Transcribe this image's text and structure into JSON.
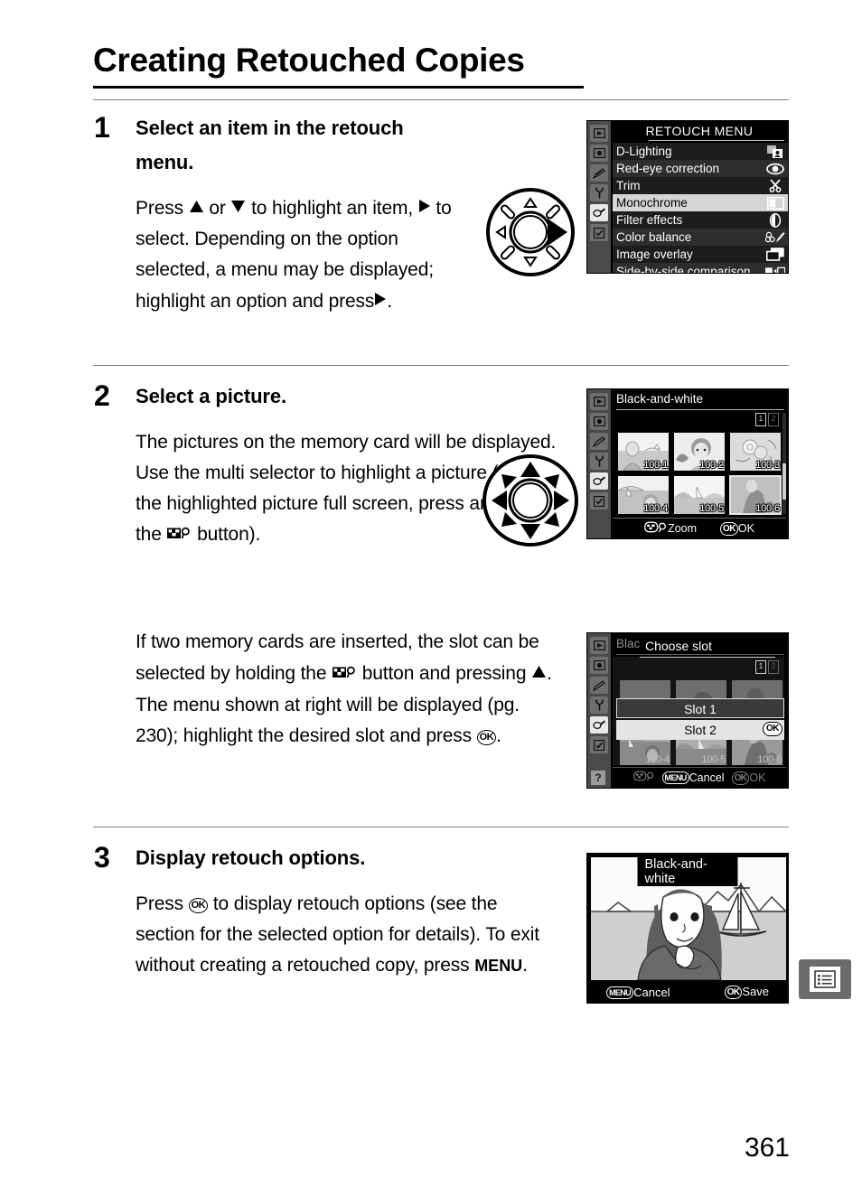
{
  "page": {
    "title": "Creating Retouched Copies",
    "number": "361",
    "side_tab_icon": "menu-list-icon"
  },
  "steps": [
    {
      "number": "1",
      "heading": "Select an item in the retouch menu.",
      "paragraphs": [
        "Press ▲ or ▼ to highlight an item, ▶ to select.  Depending on the option selected, a menu may be displayed; highlight an option and press ▶."
      ]
    },
    {
      "number": "2",
      "heading": "Select a picture.",
      "paragraphs": [
        "The pictures on the memory card will be displayed.  Use the multi selector to highlight a picture (to view the highlighted picture full screen, press and hold the ▣ button).",
        "If two memory cards are inserted, the slot can be selected by holding the ▣ button and pressing ▲.  The menu shown at right will be displayed (pg. 230); highlight the desired slot and press ⒪."
      ]
    },
    {
      "number": "3",
      "heading": "Display retouch options.",
      "paragraphs": [
        "Press ⒪ to display retouch options (see the section for the selected option for details).  To exit without creating a retouched copy, press MENU."
      ]
    }
  ],
  "step1_text": {
    "press": "Press",
    "or": "or",
    "to_highlight": "to highlight an item,",
    "to_select": "to select.  Depending on the option selected, a menu may be displayed; highlight an option and press",
    "period": "."
  },
  "step2_text": {
    "para1_a": "The pictures on the memory card will be displayed.  Use the multi selector to highlight a picture (to view the highlighted picture full screen, press and hold the",
    "para1_b": "button).",
    "para2_a": "If two memory cards are inserted, the slot can be selected by holding the",
    "para2_b": "button and pressing",
    "para2_c": ".  The menu shown at right will be displayed (pg. 230); highlight the desired slot and press",
    "para2_d": "."
  },
  "step3_text": {
    "a": "Press",
    "b": "to display retouch options (see the section for the selected option for details).  To exit without creating a retouched copy, press",
    "menu_word": "MENU",
    "c": "."
  },
  "dials": {
    "step1": {
      "name": "multi-selector-right",
      "highlighted_direction": "right"
    },
    "step2": {
      "name": "multi-selector-all",
      "highlighted_direction": "all"
    }
  },
  "lcd_retouch_menu": {
    "title": "RETOUCH MENU",
    "sidebar_icons": [
      "playback-icon",
      "shooting-menu-icon",
      "custom-settings-pencil-icon",
      "setup-wrench-icon",
      "retouch-brush-icon",
      "recent-settings-icon"
    ],
    "selected_sidebar_index": 4,
    "items": [
      {
        "label": "D-Lighting",
        "icon": "d-lighting-icon",
        "highlighted": false
      },
      {
        "label": "Red-eye correction",
        "icon": "red-eye-icon",
        "highlighted": false
      },
      {
        "label": "Trim",
        "icon": "scissors-icon",
        "highlighted": false
      },
      {
        "label": "Monochrome",
        "icon": "monochrome-icon",
        "highlighted": true
      },
      {
        "label": "Filter effects",
        "icon": "filter-effects-icon",
        "highlighted": false
      },
      {
        "label": "Color balance",
        "icon": "color-balance-icon",
        "highlighted": false
      },
      {
        "label": "Image overlay",
        "icon": "image-overlay-icon",
        "highlighted": false
      },
      {
        "label": "Side-by-side comparison",
        "icon": "side-by-side-icon",
        "highlighted": false
      }
    ]
  },
  "lcd_thumbnails": {
    "title": "Black-and-white",
    "card_indicators": [
      "1",
      "2"
    ],
    "thumbnails": [
      {
        "label": "100-1",
        "selected": false
      },
      {
        "label": "100-2",
        "selected": false
      },
      {
        "label": "100-3",
        "selected": false
      },
      {
        "label": "100-4",
        "selected": false
      },
      {
        "label": "100-5",
        "selected": false
      },
      {
        "label": "100-6",
        "selected": true
      }
    ],
    "bottom_left_label": "Zoom",
    "bottom_right_label": "OK",
    "bottom_right_badge": "OK",
    "bottom_left_badge": "zoom-thumbnail-icon"
  },
  "lcd_choose_slot": {
    "background_title": "Black-and-white",
    "dialog_title": "Choose slot",
    "options": [
      {
        "label": "Slot 1",
        "highlighted": true,
        "badge": ""
      },
      {
        "label": "Slot 2",
        "highlighted": false,
        "badge": "OK"
      }
    ],
    "card_indicators": [
      "1",
      "2"
    ],
    "thumbnails": [
      {
        "label": "100-4"
      },
      {
        "label": "100-5"
      },
      {
        "label": "100-6"
      }
    ],
    "help_badge": "?",
    "bottom_cancel": "Cancel",
    "bottom_cancel_badge": "MENU",
    "bottom_ok": "OK",
    "bottom_ok_badge": "OK",
    "bottom_zoom_badge": "zoom-thumbnail-icon"
  },
  "lcd_preview": {
    "title": "Black-and-white",
    "bottom_cancel": "Cancel",
    "bottom_cancel_badge": "MENU",
    "bottom_save": "Save",
    "bottom_save_badge": "OK"
  },
  "colors": {
    "page_bg": "#ffffff",
    "text": "#000000",
    "rule": "#808080",
    "lcd_bg": "#000000",
    "lcd_sidebar": "#4a4a4a",
    "lcd_row_odd": "#1d1d1d",
    "lcd_row_even": "#2e2e2e",
    "lcd_highlight": "#d5d5d5",
    "side_tab": "#6b6b6b"
  }
}
